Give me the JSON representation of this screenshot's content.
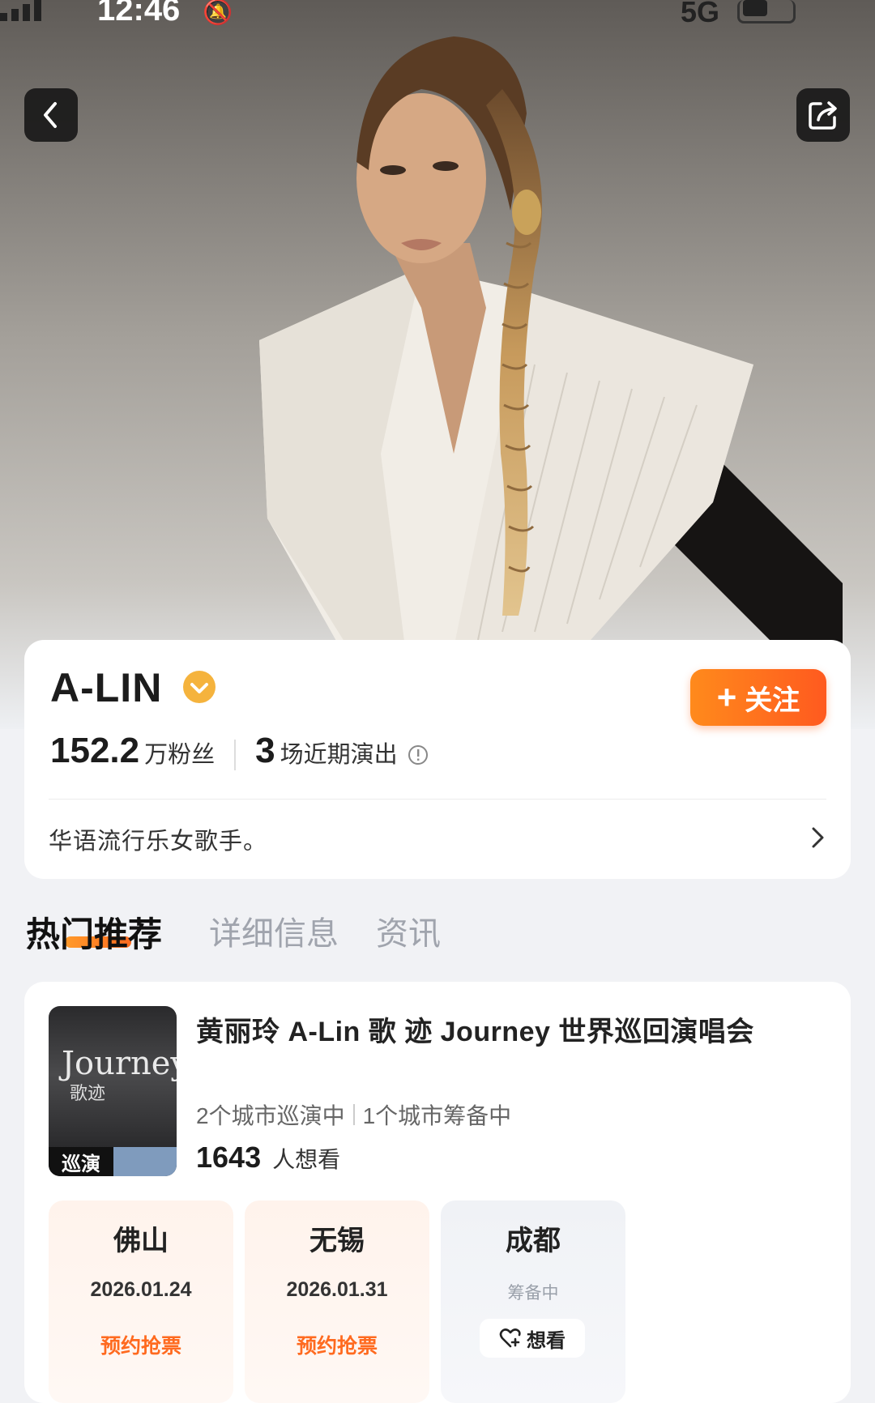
{
  "status_bar": {
    "time": "12:46",
    "network": "5G"
  },
  "icons": {
    "back": "chevron-left-icon",
    "share": "share-icon",
    "verified": "verified-badge-icon",
    "info": "info-icon",
    "bio_more": "chevron-right-icon",
    "want": "heart-plus-icon"
  },
  "colors": {
    "accent": "#ff6a1f",
    "accent_light": "#ff9a2a",
    "verified": "#f5b33d"
  },
  "profile": {
    "name": "A-LIN",
    "follow_label": "关注",
    "follow_plus": "+",
    "fans_count": "152.2",
    "fans_unit": "万粉丝",
    "shows_count": "3",
    "shows_unit": "场近期演出",
    "bio": "华语流行乐女歌手。"
  },
  "tabs": [
    {
      "label": "热门推荐",
      "active": true
    },
    {
      "label": "详细信息",
      "active": false
    },
    {
      "label": "资讯",
      "active": false
    }
  ],
  "event": {
    "poster_title": "Journey",
    "poster_subtitle": "歌迹",
    "poster_badge": "巡演",
    "title": "黄丽玲 A-Lin 歌 迹 Journey 世界巡回演唱会",
    "cities_touring": "2个城市巡演中",
    "cities_preparing": "1个城市筹备中",
    "interest_count": "1643",
    "interest_unit": "人想看",
    "cities": [
      {
        "name": "佛山",
        "date": "2026.01.24",
        "action": "预约抢票"
      },
      {
        "name": "无锡",
        "date": "2026.01.31",
        "action": "预约抢票"
      },
      {
        "name": "成都",
        "status": "筹备中",
        "action": "想看"
      }
    ]
  }
}
